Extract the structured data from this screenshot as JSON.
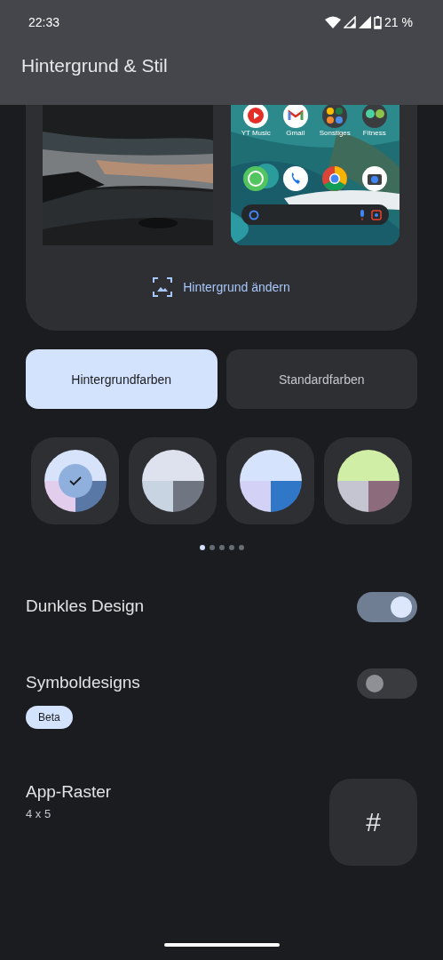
{
  "status_bar": {
    "time": "22:33",
    "battery": "21 %"
  },
  "app_bar": {
    "title": "Hintergrund & Stil"
  },
  "preview": {
    "home_apps": [
      {
        "label": "YT Music",
        "kind": "ytmusic"
      },
      {
        "label": "Gmail",
        "kind": "gmail"
      },
      {
        "label": "Sonstiges",
        "kind": "folder"
      },
      {
        "label": "Fitness",
        "kind": "folder2"
      }
    ],
    "dock": [
      {
        "kind": "whatsapp"
      },
      {
        "kind": "phone"
      },
      {
        "kind": "chrome"
      },
      {
        "kind": "camera"
      }
    ],
    "change_wallpaper": "Hintergrund ändern"
  },
  "color_tabs": [
    {
      "label": "Hintergrundfarben",
      "selected": true
    },
    {
      "label": "Standardfarben",
      "selected": false
    }
  ],
  "color_options": [
    {
      "selected": true,
      "segments": [
        {
          "color": "#d6e3fb"
        },
        {
          "color": "#e3cdec"
        },
        {
          "color": "#5a78a6"
        }
      ]
    },
    {
      "selected": false,
      "segments": [
        {
          "color": "#dee2ef"
        },
        {
          "color": "#c9d4e3"
        },
        {
          "color": "#6f7581"
        }
      ]
    },
    {
      "selected": false,
      "segments": [
        {
          "color": "#d5e3fc"
        },
        {
          "color": "#d3d2f6"
        },
        {
          "color": "#3177c7"
        }
      ]
    },
    {
      "selected": false,
      "segments": [
        {
          "color": "#d1eea6"
        },
        {
          "color": "#c4c5d1"
        },
        {
          "color": "#8b6b7c"
        }
      ]
    }
  ],
  "pages": [
    {
      "selected": true
    },
    {
      "selected": false
    },
    {
      "selected": false
    },
    {
      "selected": false
    },
    {
      "selected": false
    }
  ],
  "settings": [
    {
      "kind": "toggle",
      "label": "Dunkles Design",
      "on": true
    },
    {
      "kind": "toggle",
      "label": "Symboldesigns",
      "on": false,
      "badge": "Beta"
    },
    {
      "kind": "grid",
      "label": "App-Raster",
      "value": "4 x 5",
      "icon": "#"
    }
  ]
}
